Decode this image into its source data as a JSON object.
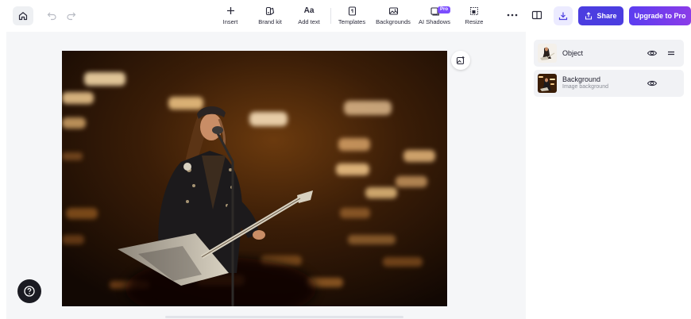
{
  "toolbar": {
    "tools": [
      {
        "label": "Insert",
        "icon": "plus-icon"
      },
      {
        "label": "Brand kit",
        "icon": "brand-kit-icon"
      },
      {
        "label": "Add text",
        "icon": "text-icon"
      },
      {
        "label": "Templates",
        "icon": "templates-icon"
      },
      {
        "label": "Backgrounds",
        "icon": "backgrounds-icon"
      },
      {
        "label": "AI Shadows",
        "icon": "ai-shadows-icon"
      },
      {
        "label": "Resize",
        "icon": "resize-icon"
      }
    ],
    "pro_badge": "Pro",
    "share_label": "Share",
    "upgrade_label": "Upgrade to Pro"
  },
  "layers": [
    {
      "name": "Object",
      "subtitle": ""
    },
    {
      "name": "Background",
      "subtitle": "Image background"
    }
  ],
  "colors": {
    "accent": "#4b3de0",
    "upgrade_gradient_start": "#5b3df0",
    "upgrade_gradient_end": "#8b3ce8",
    "canvas_bg": "#f5f6f8"
  }
}
